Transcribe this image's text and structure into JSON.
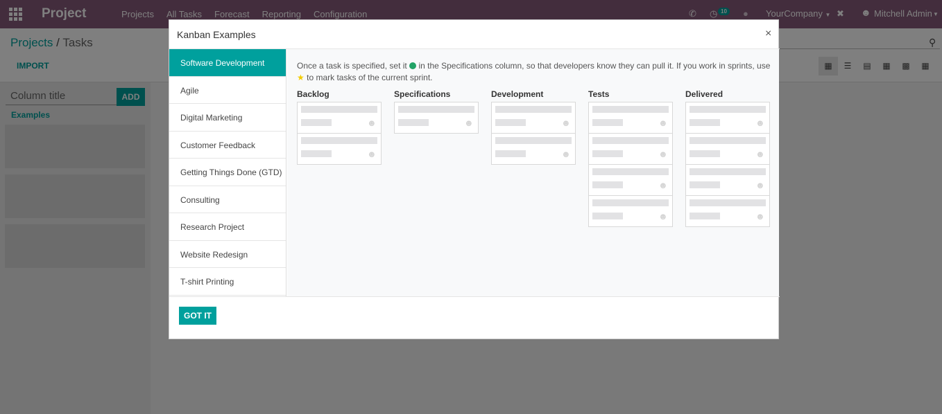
{
  "navbar": {
    "app_name": "Project",
    "menu": [
      "Projects",
      "All Tasks",
      "Forecast",
      "Reporting",
      "Configuration"
    ],
    "activity_count": "10",
    "company": "YourCompany",
    "user": "Mitchell Admin",
    "color": "#875a7b"
  },
  "control_panel": {
    "breadcrumb_root": "Projects",
    "breadcrumb_sep": "/",
    "breadcrumb_current": "Tasks",
    "import_label": "IMPORT"
  },
  "kanban": {
    "column_title_placeholder": "Column title",
    "add_label": "ADD",
    "examples_label": "Examples"
  },
  "modal": {
    "title": "Kanban Examples",
    "close": "×",
    "examples": [
      "Software Development",
      "Agile",
      "Digital Marketing",
      "Customer Feedback",
      "Getting Things Done (GTD)",
      "Consulting",
      "Research Project",
      "Website Redesign",
      "T-shirt Printing"
    ],
    "active_example": "Software Development",
    "desc_part1": "Once a task is specified, set it",
    "desc_part2": "in the Specifications column, so that developers know they can pull it. If you work in sprints, use",
    "desc_part3": "to mark tasks of the current sprint.",
    "columns": [
      {
        "name": "Backlog",
        "cards": 2
      },
      {
        "name": "Specifications",
        "cards": 1
      },
      {
        "name": "Development",
        "cards": 2
      },
      {
        "name": "Tests",
        "cards": 4
      },
      {
        "name": "Delivered",
        "cards": 4
      }
    ],
    "got_it_label": "GOT IT",
    "accent": "#00a09d"
  }
}
